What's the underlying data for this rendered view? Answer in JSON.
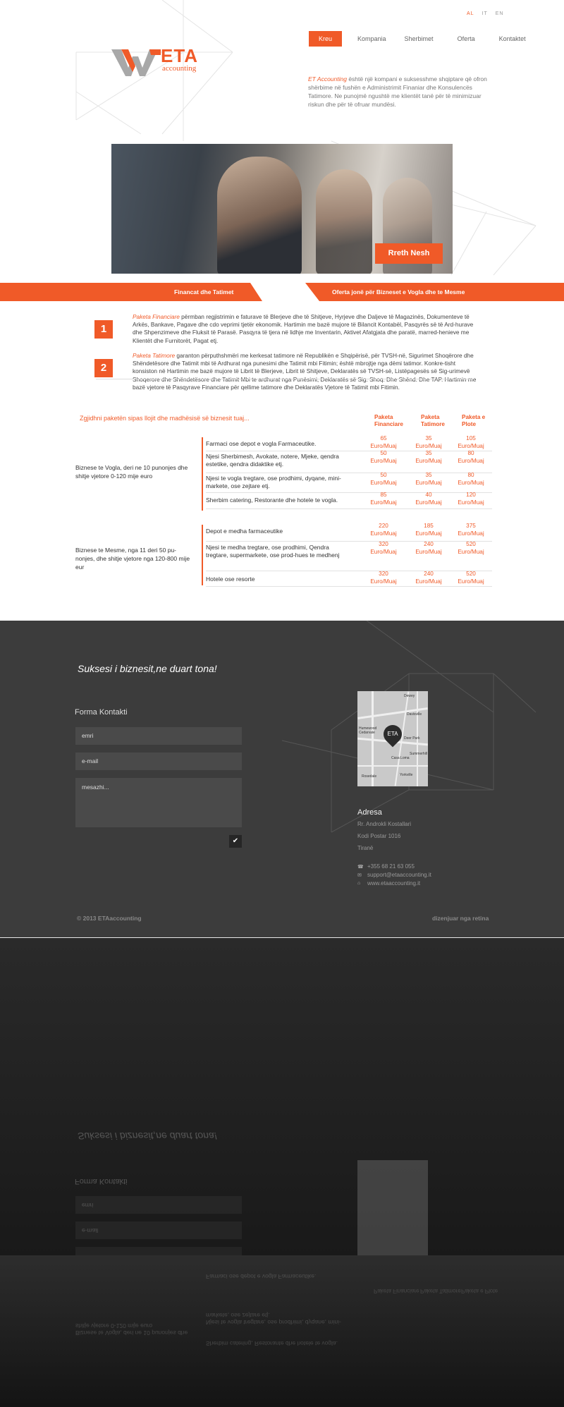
{
  "header": {
    "languages": [
      "AL",
      "IT",
      "EN"
    ],
    "nav": [
      "Kreu",
      "Kompania",
      "Sherbimet",
      "Oferta",
      "Kontaktet"
    ],
    "logo_text": "ETA",
    "logo_sub": "accounting",
    "intro_hl": "ET Accounting",
    "intro_rest": " është një kompani e suksesshme shqiptare që ofron shërbime në fushën e Administrimit Finaniar dhe Konsulencës Tatimore. Ne punojmë ngushtë me klientët tanë për të minimizuar riskun dhe për të ofruar mundësi."
  },
  "hero": {
    "button": "Rreth Nesh"
  },
  "bars": {
    "left": "Financat dhe Tatimet",
    "right": "Oferta jonë për Bizneset e Vogla dhe te Mesme"
  },
  "blocks": [
    {
      "num": "1",
      "hl": "Paketa Financiare",
      "text": " përmban regjistrimin e faturave të Blerjeve dhe të Shitjeve, Hyrjeve dhe Daljeve të Magazinës, Dokumenteve të Arkës, Bankave, Pagave dhe cdo veprimi tjetër ekonomik. Hartimin me bazë mujore të Bilancit Kontabël, Pasqyrës së të Ard-hurave dhe Shpenzimeve dhe Fluksit të Parasë. Pasqyra të tjera në lidhje me Inventarin, Aktivet Afatgjata dhe paratë, marred-henieve me Klientët dhe Furnitorët, Pagat etj."
    },
    {
      "num": "2",
      "hl": "Paketa Tatimore",
      "text": " garanton përputhshmëri me kerkesat tatimore në Republikën e Shqipërisë, për TVSH-në, Sigurimet Shoqërore dhe Shëndetësore dhe Tatimit mbi të Ardhurat nga punesimi dhe Tatimit mbi Fitimin; është mbrojtje nga dëmi tatimor. Konkre-tisht konsiston në Hartimin me bazë mujore të Librit të Blerjeve, Librit të Shitjeve, Deklaratës së TVSH-së, Listëpagesës së Sig-urimevë Shoqerore dhe Shëndetësore dhe Tatimit Mbi te ardhurat nga Punësimi, Deklaratës së Sig. Shoq. Dhe Shënd. Dhe TAP. Hartimin me bazë vjetore të Pasqyrave Financiare për qellime tatimore dhe Deklaratës Vjetore të Tatimit mbi Fitimin."
    }
  ],
  "pricing": {
    "intro": "Zgjidhni paketën sipas llojit dhe madhësisë së biznesit tuaj...",
    "headers": [
      "Paketa Financiare",
      "Paketa Tatimore",
      "Paketa e Plote"
    ],
    "groups": [
      {
        "name": "Biznese te Vogla, deri ne 10 punonjes dhe shitje vjetore 0-120 mije euro",
        "rows": [
          {
            "label": "Farmaci ose depot e vogla  Farmaceutike.",
            "prices": [
              "65",
              "35",
              "105"
            ]
          },
          {
            "label": "Njesi Sherbimesh, Avokate, notere, Mjeke, qendra estetike, qendra didaktike etj.",
            "prices": [
              "50",
              "35",
              "80"
            ]
          },
          {
            "label": "Njesi te vogla tregtare, ose prodhimi, dyqane, mini-markete, ose zejtare etj.",
            "prices": [
              "50",
              "35",
              "80"
            ]
          },
          {
            "label": "Sherbim catering, Restorante dhe hotele te vogla.",
            "prices": [
              "85",
              "40",
              "120"
            ]
          }
        ]
      },
      {
        "name": "Biznese te Mesme, nga 11 deri 50 pu-nonjes, dhe shitje vjetore nga 120-800 mije eur",
        "rows": [
          {
            "label": "Depot e medha farmaceutike",
            "prices": [
              "220",
              "185",
              "375"
            ]
          },
          {
            "label": "Njesi te medha tregtare, ose prodhimi, Qendra tregtare, supermarkete, ose prod-hues te medhenj",
            "prices": [
              "320",
              "240",
              "520"
            ]
          },
          {
            "label": "Hotele ose resorte",
            "prices": [
              "320",
              "240",
              "520"
            ]
          }
        ]
      }
    ],
    "unit": "Euro/Muaj"
  },
  "contact": {
    "slogan": "Suksesi i biznesit,ne duart tona!",
    "form_title": "Forma Kontakti",
    "name_placeholder": "emri",
    "email_placeholder": "e-mail",
    "message_placeholder": "mesazhi...",
    "map_label": "ETA",
    "map_labels": [
      "Dewey",
      "Humewood Cedarvale",
      "Deer Park",
      "Casa Loma",
      "Summerhill",
      "Davisville",
      "Yorkville",
      "Rosedale"
    ],
    "address_title": "Adresa",
    "address_lines": [
      "Rr. Androkli Kostallari",
      "Kodi Postar 1016",
      "Tiranë"
    ],
    "phone": "+355 68 21 63 055",
    "email": "support@etaaccounting.it",
    "web": "www.etaaccounting.it"
  },
  "footer": {
    "copyright": "© 2013  ETAaccounting",
    "designed": "dizenjuar nga retina"
  }
}
